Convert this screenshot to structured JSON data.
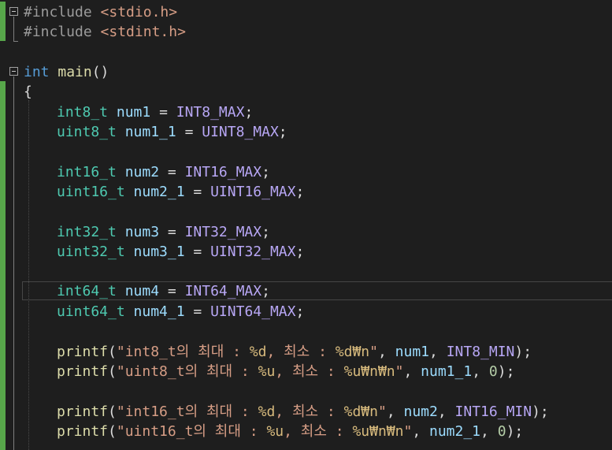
{
  "lines": {
    "l1": {
      "pre": "#include ",
      "hdr": "<stdio.h>"
    },
    "l2": {
      "pre": "#include ",
      "hdr": "<stdint.h>"
    },
    "l4": {
      "kw": "int",
      "fn": "main",
      "p": "()"
    },
    "l5": {
      "p": "{"
    },
    "l6": {
      "type": "int8_t",
      "var": "num1",
      "op": " = ",
      "macro": "INT8_MAX",
      "end": ";"
    },
    "l7": {
      "type": "uint8_t",
      "var": "num1_1",
      "op": " = ",
      "macro": "UINT8_MAX",
      "end": ";"
    },
    "l9": {
      "type": "int16_t",
      "var": "num2",
      "op": " = ",
      "macro": "INT16_MAX",
      "end": ";"
    },
    "l10": {
      "type": "uint16_t",
      "var": "num2_1",
      "op": " = ",
      "macro": "UINT16_MAX",
      "end": ";"
    },
    "l12": {
      "type": "int32_t",
      "var": "num3",
      "op": " = ",
      "macro": "INT32_MAX",
      "end": ";"
    },
    "l13": {
      "type": "uint32_t",
      "var": "num3_1",
      "op": " = ",
      "macro": "UINT32_MAX",
      "end": ";"
    },
    "l15": {
      "type": "int64_t",
      "var": "num4",
      "op": " = ",
      "macro": "INT64_MAX",
      "end": ";"
    },
    "l16": {
      "type": "uint64_t",
      "var": "num4_1",
      "op": " = ",
      "macro": "UINT64_MAX",
      "end": ";"
    },
    "l18": {
      "fn": "printf",
      "open": "(",
      "s1": "\"int8_t의 최대 : ",
      "f1": "%d",
      "s2": ", 최소 : ",
      "f2": "%d₩n",
      "s3": "\"",
      "c1": ", ",
      "a1": "num1",
      "c2": ", ",
      "a2": "INT8_MIN",
      "close": ");"
    },
    "l19": {
      "fn": "printf",
      "open": "(",
      "s1": "\"uint8_t의 최대 : ",
      "f1": "%u",
      "s2": ", 최소 : ",
      "f2": "%u₩n₩n",
      "s3": "\"",
      "c1": ", ",
      "a1": "num1_1",
      "c2": ", ",
      "a2": "0",
      "close": ");"
    },
    "l21": {
      "fn": "printf",
      "open": "(",
      "s1": "\"int16_t의 최대 : ",
      "f1": "%d",
      "s2": ", 최소 : ",
      "f2": "%d₩n",
      "s3": "\"",
      "c1": ", ",
      "a1": "num2",
      "c2": ", ",
      "a2": "INT16_MIN",
      "close": ");"
    },
    "l22": {
      "fn": "printf",
      "open": "(",
      "s1": "\"uint16_t의 최대 : ",
      "f1": "%u",
      "s2": ", 최소 : ",
      "f2": "%u₩n₩n",
      "s3": "\"",
      "c1": ", ",
      "a1": "num2_1",
      "c2": ", ",
      "a2": "0",
      "close": ");"
    }
  },
  "colors": {
    "background": "#1e1e1e",
    "keyword": "#569cd6",
    "type": "#4ec9b0",
    "function": "#dcdcaa",
    "variable": "#9cdcfe",
    "macro": "#b8a7f5",
    "string": "#d69d85",
    "change_bar": "#57a64a"
  }
}
